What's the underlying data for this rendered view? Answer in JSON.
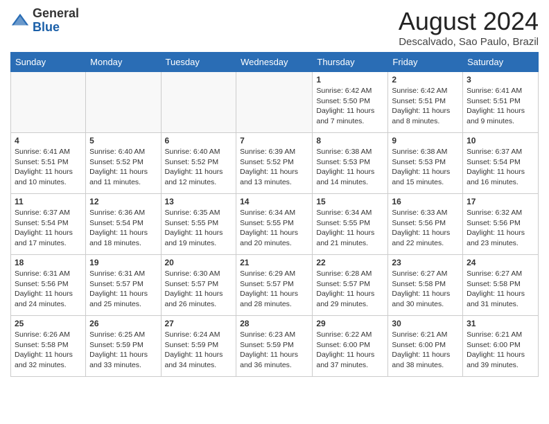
{
  "header": {
    "logo_line1": "General",
    "logo_line2": "Blue",
    "month_year": "August 2024",
    "location": "Descalvado, Sao Paulo, Brazil"
  },
  "weekdays": [
    "Sunday",
    "Monday",
    "Tuesday",
    "Wednesday",
    "Thursday",
    "Friday",
    "Saturday"
  ],
  "weeks": [
    [
      {
        "day": "",
        "info": ""
      },
      {
        "day": "",
        "info": ""
      },
      {
        "day": "",
        "info": ""
      },
      {
        "day": "",
        "info": ""
      },
      {
        "day": "1",
        "info": "Sunrise: 6:42 AM\nSunset: 5:50 PM\nDaylight: 11 hours\nand 7 minutes."
      },
      {
        "day": "2",
        "info": "Sunrise: 6:42 AM\nSunset: 5:51 PM\nDaylight: 11 hours\nand 8 minutes."
      },
      {
        "day": "3",
        "info": "Sunrise: 6:41 AM\nSunset: 5:51 PM\nDaylight: 11 hours\nand 9 minutes."
      }
    ],
    [
      {
        "day": "4",
        "info": "Sunrise: 6:41 AM\nSunset: 5:51 PM\nDaylight: 11 hours\nand 10 minutes."
      },
      {
        "day": "5",
        "info": "Sunrise: 6:40 AM\nSunset: 5:52 PM\nDaylight: 11 hours\nand 11 minutes."
      },
      {
        "day": "6",
        "info": "Sunrise: 6:40 AM\nSunset: 5:52 PM\nDaylight: 11 hours\nand 12 minutes."
      },
      {
        "day": "7",
        "info": "Sunrise: 6:39 AM\nSunset: 5:52 PM\nDaylight: 11 hours\nand 13 minutes."
      },
      {
        "day": "8",
        "info": "Sunrise: 6:38 AM\nSunset: 5:53 PM\nDaylight: 11 hours\nand 14 minutes."
      },
      {
        "day": "9",
        "info": "Sunrise: 6:38 AM\nSunset: 5:53 PM\nDaylight: 11 hours\nand 15 minutes."
      },
      {
        "day": "10",
        "info": "Sunrise: 6:37 AM\nSunset: 5:54 PM\nDaylight: 11 hours\nand 16 minutes."
      }
    ],
    [
      {
        "day": "11",
        "info": "Sunrise: 6:37 AM\nSunset: 5:54 PM\nDaylight: 11 hours\nand 17 minutes."
      },
      {
        "day": "12",
        "info": "Sunrise: 6:36 AM\nSunset: 5:54 PM\nDaylight: 11 hours\nand 18 minutes."
      },
      {
        "day": "13",
        "info": "Sunrise: 6:35 AM\nSunset: 5:55 PM\nDaylight: 11 hours\nand 19 minutes."
      },
      {
        "day": "14",
        "info": "Sunrise: 6:34 AM\nSunset: 5:55 PM\nDaylight: 11 hours\nand 20 minutes."
      },
      {
        "day": "15",
        "info": "Sunrise: 6:34 AM\nSunset: 5:55 PM\nDaylight: 11 hours\nand 21 minutes."
      },
      {
        "day": "16",
        "info": "Sunrise: 6:33 AM\nSunset: 5:56 PM\nDaylight: 11 hours\nand 22 minutes."
      },
      {
        "day": "17",
        "info": "Sunrise: 6:32 AM\nSunset: 5:56 PM\nDaylight: 11 hours\nand 23 minutes."
      }
    ],
    [
      {
        "day": "18",
        "info": "Sunrise: 6:31 AM\nSunset: 5:56 PM\nDaylight: 11 hours\nand 24 minutes."
      },
      {
        "day": "19",
        "info": "Sunrise: 6:31 AM\nSunset: 5:57 PM\nDaylight: 11 hours\nand 25 minutes."
      },
      {
        "day": "20",
        "info": "Sunrise: 6:30 AM\nSunset: 5:57 PM\nDaylight: 11 hours\nand 26 minutes."
      },
      {
        "day": "21",
        "info": "Sunrise: 6:29 AM\nSunset: 5:57 PM\nDaylight: 11 hours\nand 28 minutes."
      },
      {
        "day": "22",
        "info": "Sunrise: 6:28 AM\nSunset: 5:57 PM\nDaylight: 11 hours\nand 29 minutes."
      },
      {
        "day": "23",
        "info": "Sunrise: 6:27 AM\nSunset: 5:58 PM\nDaylight: 11 hours\nand 30 minutes."
      },
      {
        "day": "24",
        "info": "Sunrise: 6:27 AM\nSunset: 5:58 PM\nDaylight: 11 hours\nand 31 minutes."
      }
    ],
    [
      {
        "day": "25",
        "info": "Sunrise: 6:26 AM\nSunset: 5:58 PM\nDaylight: 11 hours\nand 32 minutes."
      },
      {
        "day": "26",
        "info": "Sunrise: 6:25 AM\nSunset: 5:59 PM\nDaylight: 11 hours\nand 33 minutes."
      },
      {
        "day": "27",
        "info": "Sunrise: 6:24 AM\nSunset: 5:59 PM\nDaylight: 11 hours\nand 34 minutes."
      },
      {
        "day": "28",
        "info": "Sunrise: 6:23 AM\nSunset: 5:59 PM\nDaylight: 11 hours\nand 36 minutes."
      },
      {
        "day": "29",
        "info": "Sunrise: 6:22 AM\nSunset: 6:00 PM\nDaylight: 11 hours\nand 37 minutes."
      },
      {
        "day": "30",
        "info": "Sunrise: 6:21 AM\nSunset: 6:00 PM\nDaylight: 11 hours\nand 38 minutes."
      },
      {
        "day": "31",
        "info": "Sunrise: 6:21 AM\nSunset: 6:00 PM\nDaylight: 11 hours\nand 39 minutes."
      }
    ]
  ]
}
